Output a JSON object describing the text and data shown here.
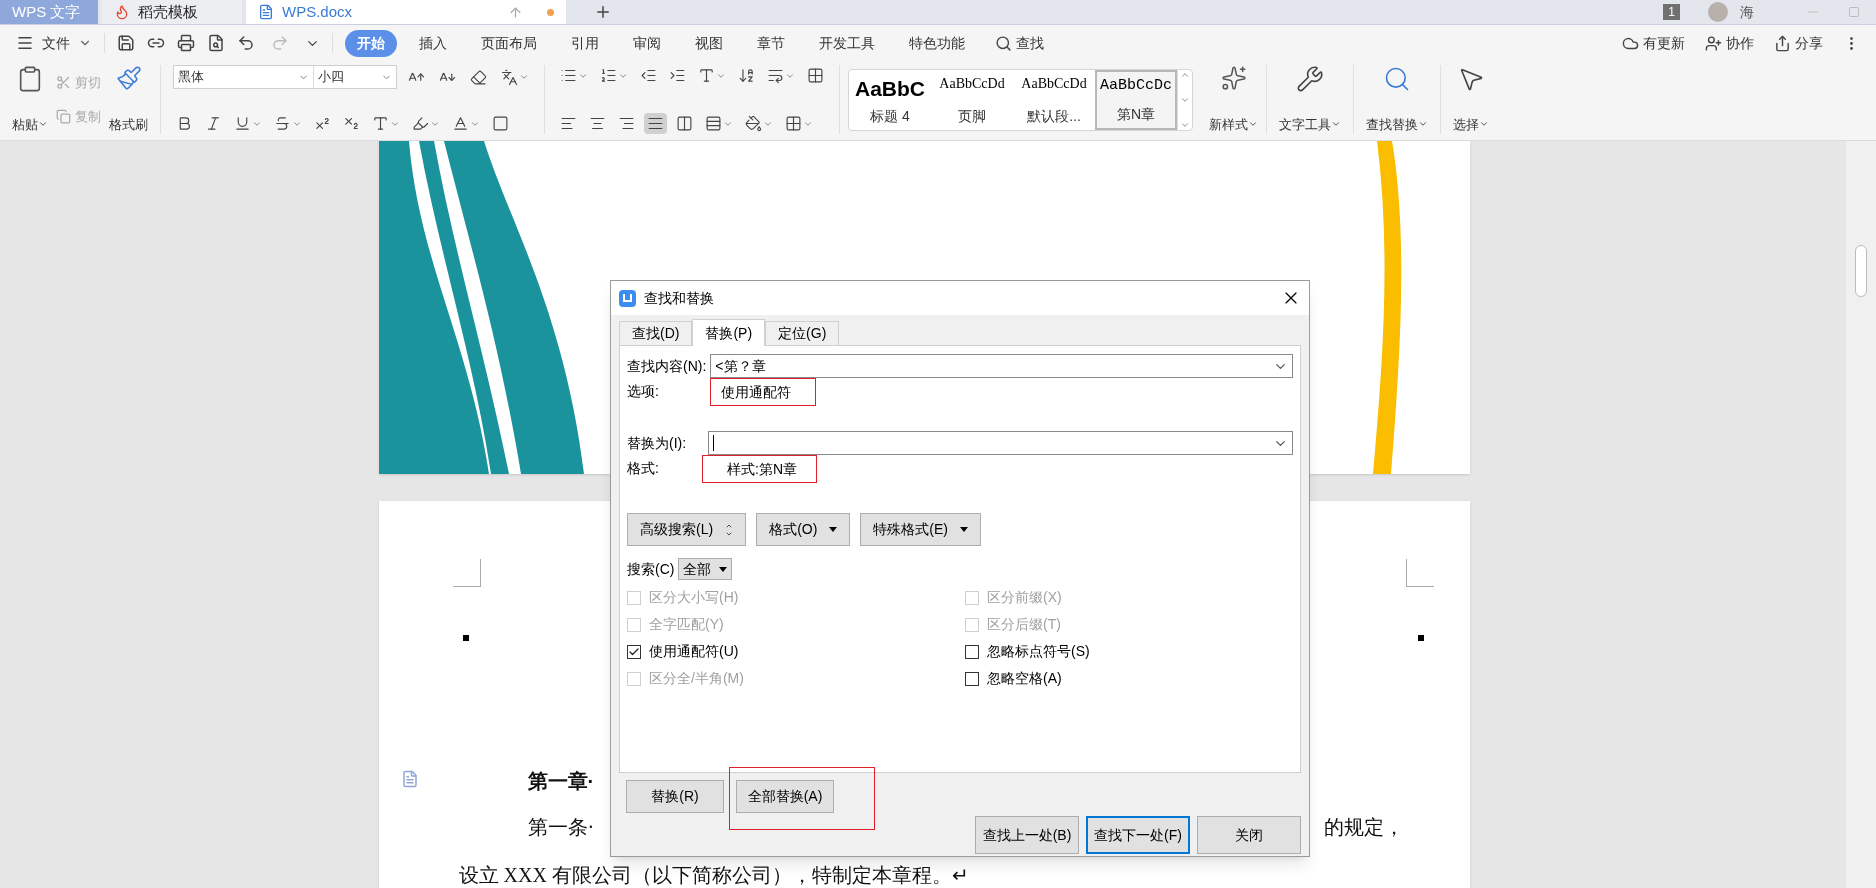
{
  "tabs": [
    {
      "label": "WPS 文字",
      "kind": "home",
      "selected": false
    },
    {
      "label": "稻壳模板",
      "kind": "template",
      "selected": false
    },
    {
      "label": "WPS.docx",
      "kind": "document",
      "selected": true
    }
  ],
  "window_controls": {
    "page_count": "1",
    "user": "海"
  },
  "menu": {
    "file": "文件",
    "items": [
      {
        "label": "开始",
        "selected": true
      },
      {
        "label": "插入",
        "selected": false
      },
      {
        "label": "页面布局",
        "selected": false
      },
      {
        "label": "引用",
        "selected": false
      },
      {
        "label": "审阅",
        "selected": false
      },
      {
        "label": "视图",
        "selected": false
      },
      {
        "label": "章节",
        "selected": false
      },
      {
        "label": "开发工具",
        "selected": false
      },
      {
        "label": "特色功能",
        "selected": false
      }
    ],
    "search": "查找",
    "right": [
      "有更新",
      "协作",
      "分享"
    ]
  },
  "ribbon": {
    "paste": "粘贴",
    "cut": {
      "label": "剪切",
      "disabled": true
    },
    "copy": {
      "label": "复制",
      "disabled": true
    },
    "format_painter": "格式刷",
    "font": "黑体",
    "size": "小四",
    "alignment": [
      {
        "selected": false
      },
      {
        "selected": false
      },
      {
        "selected": false
      },
      {
        "selected": true
      }
    ],
    "styles": [
      {
        "preview": "AaBbC",
        "name": "标题 4",
        "kind": "heading",
        "selected": false
      },
      {
        "preview": "AaBbCcDd",
        "name": "页脚",
        "kind": "serif",
        "selected": false
      },
      {
        "preview": "AaBbCcDd",
        "name": "默认段...",
        "kind": "serif",
        "selected": false
      },
      {
        "preview": "AaBbCcDc",
        "name": "第N章",
        "kind": "mono",
        "selected": true
      }
    ],
    "new_style": "新样式",
    "text_tools": "文字工具",
    "find_replace": "查找替换",
    "select": "选择"
  },
  "document": {
    "heading": "第一章·",
    "line_1_start": "第一条·",
    "line_1_end": "的规定，",
    "line_2": "设立 XXX 有限公司（以下简称公司），特制定本章程。↵"
  },
  "dialog": {
    "title": "查找和替换",
    "tabs": [
      {
        "label": "查找(D)",
        "selected": false
      },
      {
        "label": "替换(P)",
        "selected": true
      },
      {
        "label": "定位(G)",
        "selected": false
      }
    ],
    "find_label": "查找内容(N):",
    "find_value": "<第？章",
    "options_label": "选项:",
    "options_value": {
      "text": "使用通配符",
      "highlighted": true
    },
    "replace_label": "替换为(I):",
    "format_label": "格式:",
    "format_value": {
      "text": "样式:第N章",
      "highlighted": true
    },
    "buttons": [
      {
        "label": "高级搜索(L)",
        "kind": "toggle"
      },
      {
        "label": "格式(O)",
        "kind": "menu"
      },
      {
        "label": "特殊格式(E)",
        "kind": "menu"
      }
    ],
    "search_label": "搜索(C)",
    "search_scope": "全部",
    "checkboxes_left": [
      {
        "label": "区分大小写(H)",
        "checked": false,
        "disabled": true
      },
      {
        "label": "全字匹配(Y)",
        "checked": false,
        "disabled": true
      },
      {
        "label": "使用通配符(U)",
        "checked": true,
        "disabled": false
      },
      {
        "label": "区分全/半角(M)",
        "checked": false,
        "disabled": true
      }
    ],
    "checkboxes_right": [
      {
        "label": "区分前缀(X)",
        "checked": false,
        "disabled": true
      },
      {
        "label": "区分后缀(T)",
        "checked": false,
        "disabled": true
      },
      {
        "label": "忽略标点符号(S)",
        "checked": false,
        "disabled": false
      },
      {
        "label": "忽略空格(A)",
        "checked": false,
        "disabled": false
      }
    ],
    "replace_buttons": [
      {
        "label": "替换(R)",
        "highlighted": false
      },
      {
        "label": "全部替换(A)",
        "highlighted": true
      }
    ],
    "footer_buttons": [
      {
        "label": "查找上一处(B)",
        "selected": false
      },
      {
        "label": "查找下一处(F)",
        "selected": true
      },
      {
        "label": "关闭",
        "selected": false
      }
    ]
  }
}
